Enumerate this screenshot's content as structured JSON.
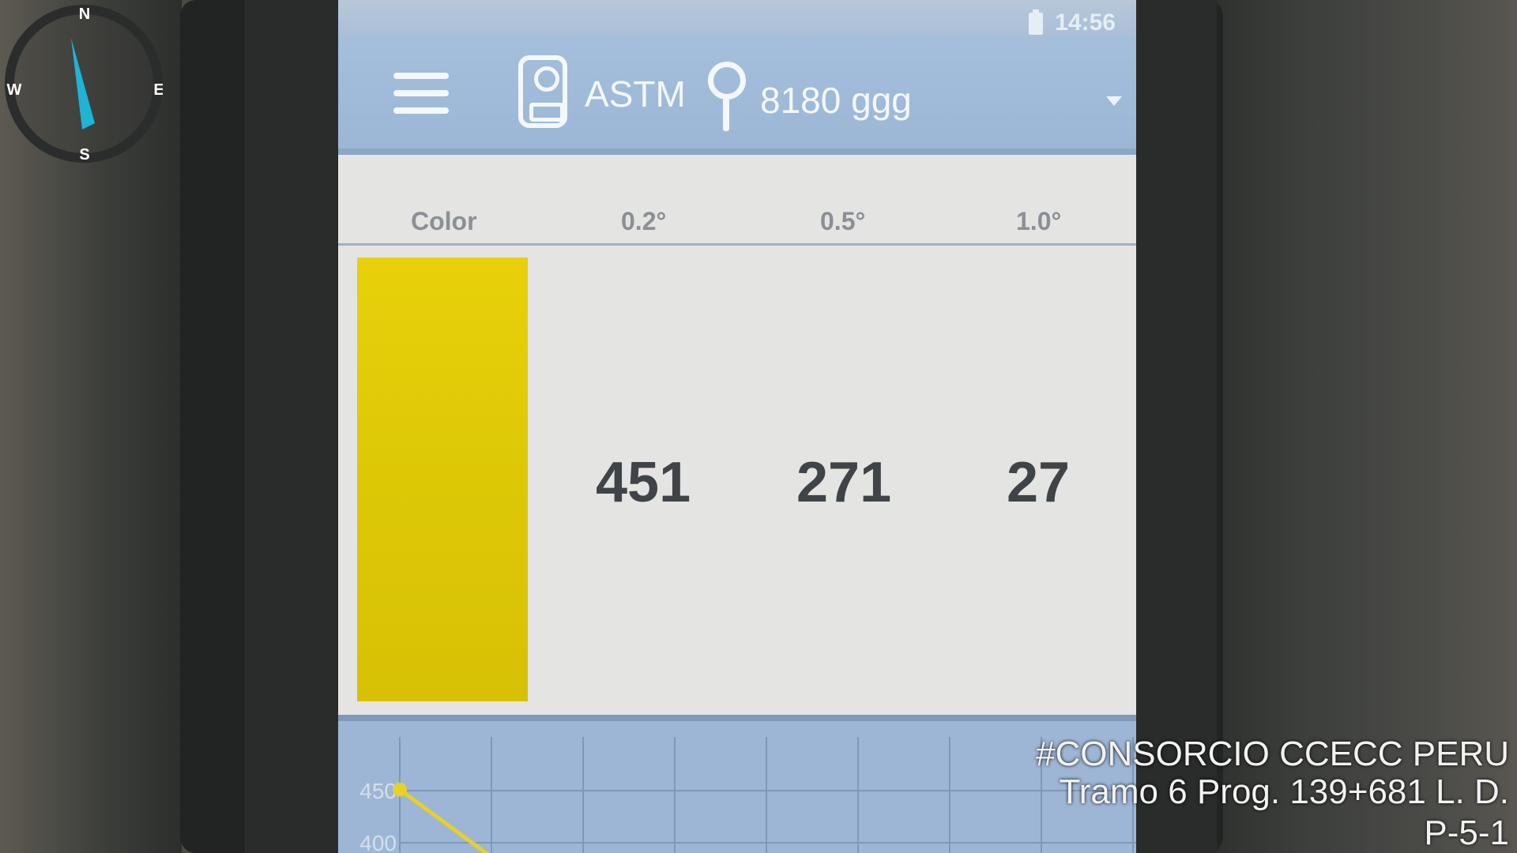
{
  "status_bar": {
    "time": "14:56",
    "battery_icon": "battery-icon"
  },
  "app_bar": {
    "menu_icon": "hamburger-menu-icon",
    "device_icon": "retroreflectometer-icon",
    "standard": "ASTM",
    "location_icon": "location-pin-icon",
    "location": "8180 ggg",
    "dropdown_icon": "chevron-down-icon"
  },
  "table": {
    "headers": [
      "Color",
      "0.2°",
      "0.5°",
      "1.0°"
    ],
    "swatch_color": "#ddc806",
    "readings": [
      "451",
      "271",
      "27"
    ]
  },
  "chart_data": {
    "type": "line",
    "y_ticks": [
      "450",
      "400"
    ],
    "points": [
      {
        "x": 0,
        "y": 451
      }
    ],
    "line_color": "#e8cf2a",
    "grid": true
  },
  "compass": {
    "north": "N",
    "south": "S",
    "east": "E",
    "west": "W",
    "needle_color": "#1fb3d6"
  },
  "watermark": {
    "line1": "#CONSORCIO CCECC PERU",
    "line2": "Tramo 6 Prog. 139+681 L. D.",
    "line3": "P-5-1"
  }
}
